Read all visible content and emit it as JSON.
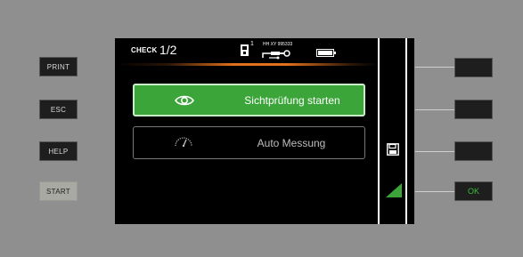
{
  "left_buttons": [
    {
      "label": "PRINT"
    },
    {
      "label": "ESC"
    },
    {
      "label": "HELP"
    },
    {
      "label": "START"
    }
  ],
  "header": {
    "logo_text": "CHECK",
    "page_indicator": "1/2",
    "device_slot": "1",
    "reference_text": "HH XY 995333",
    "icons": [
      "device-icon",
      "probe-icon",
      "battery-icon"
    ]
  },
  "menu": {
    "items": [
      {
        "label": "Sichtprüfung starten",
        "icon": "eye-icon",
        "state": "selected"
      },
      {
        "label": "Auto Messung",
        "icon": "gauge-icon",
        "state": "normal"
      }
    ]
  },
  "softkeys": [
    {
      "icon": "",
      "label": ""
    },
    {
      "icon": "",
      "label": ""
    },
    {
      "icon": "save-icon",
      "label": ""
    },
    {
      "icon": "confirm-triangle-icon",
      "label": "OK"
    }
  ],
  "colors": {
    "accent_green": "#3ba53a",
    "accent_orange": "#e2711d",
    "ok_text": "#3bbb3b"
  }
}
